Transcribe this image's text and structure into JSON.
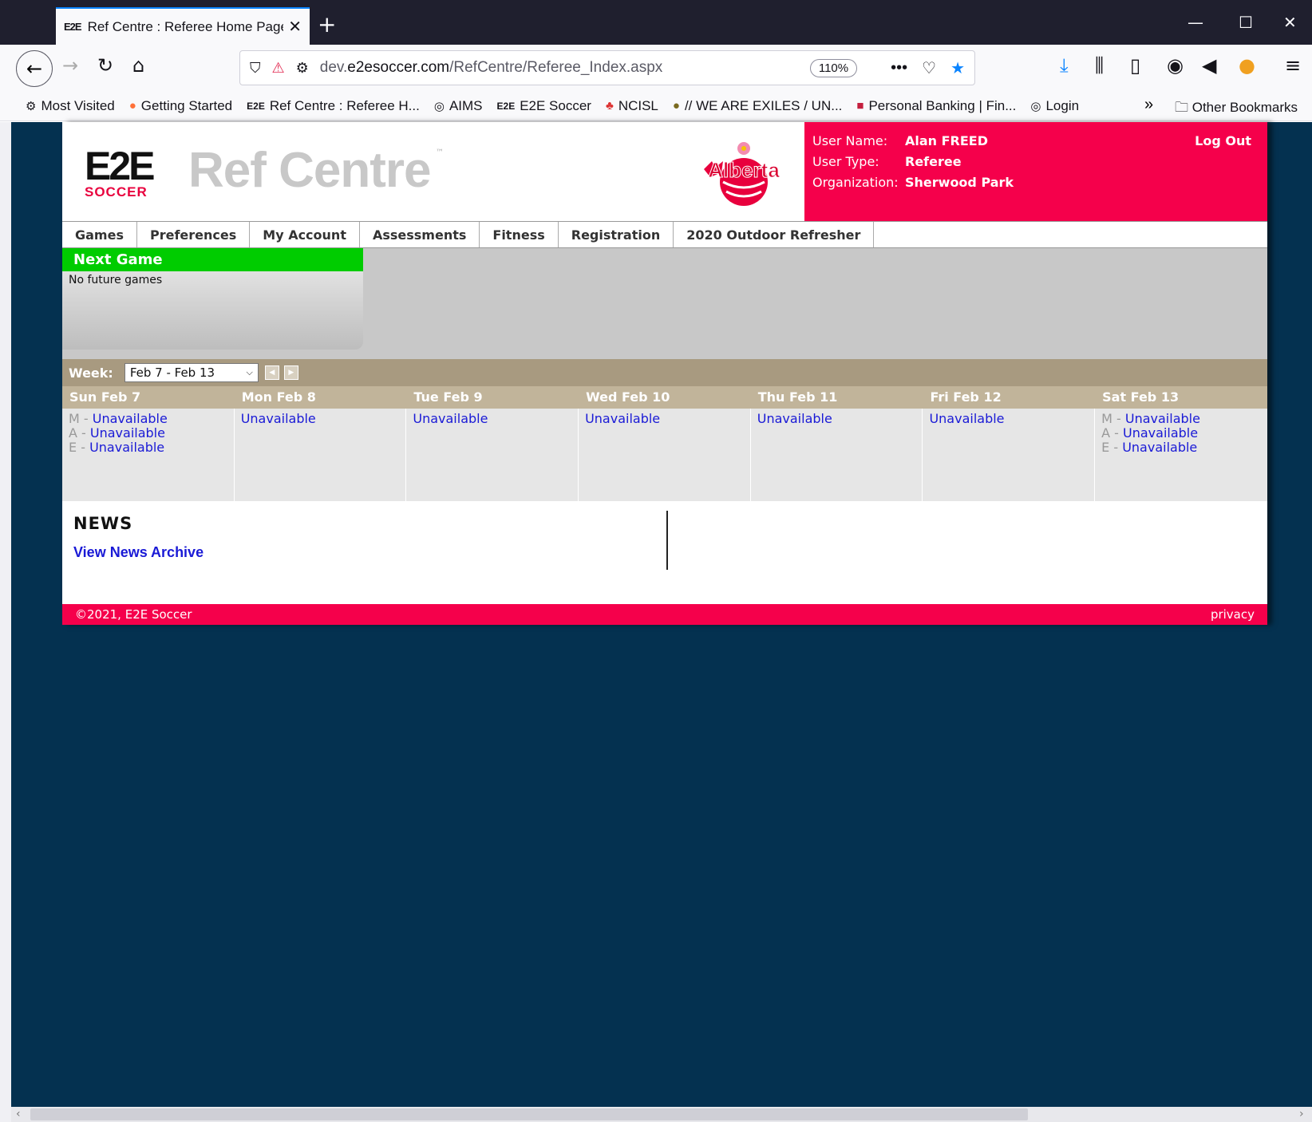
{
  "browser": {
    "tab_title": "Ref Centre : Referee Home Page",
    "tab_favicon": "E2E",
    "url_prefix": "dev.",
    "url_domain": "e2esoccer.com",
    "url_path": "/RefCentre/Referee_Index.aspx",
    "zoom": "110%",
    "bookmarks": [
      {
        "icon": "gear-icon",
        "glyph": "⚙",
        "label": "Most Visited"
      },
      {
        "icon": "firefox-icon",
        "glyph": "●",
        "label": "Getting Started"
      },
      {
        "icon": "e2e-icon",
        "glyph": "E2E",
        "label": "Ref Centre : Referee H..."
      },
      {
        "icon": "globe-icon",
        "glyph": "◎",
        "label": "AIMS"
      },
      {
        "icon": "e2e-icon",
        "glyph": "E2E",
        "label": "E2E Soccer"
      },
      {
        "icon": "ncisl-icon",
        "glyph": "♣",
        "label": "NCISL"
      },
      {
        "icon": "exiles-icon",
        "glyph": "●",
        "label": "// WE ARE EXILES / UN..."
      },
      {
        "icon": "cibc-icon",
        "glyph": "■",
        "label": "Personal Banking | Fin..."
      },
      {
        "icon": "globe-icon",
        "glyph": "◎",
        "label": "Login"
      }
    ],
    "other_bookmarks": "Other Bookmarks"
  },
  "site": {
    "logo_text": "E2E",
    "logo_sub": "SOCCER",
    "brand": "Ref Centre",
    "tm": "™",
    "alberta_logo": "Alberta"
  },
  "user": {
    "name_label": "User Name:",
    "name": "Alan FREED",
    "type_label": "User Type:",
    "type": "Referee",
    "org_label": "Organization:",
    "org": "Sherwood Park",
    "logout": "Log Out"
  },
  "menu": [
    "Games",
    "Preferences",
    "My Account",
    "Assessments",
    "Fitness",
    "Registration",
    "2020 Outdoor Refresher"
  ],
  "next_game": {
    "title": "Next Game",
    "text": "No future games"
  },
  "week": {
    "label": "Week:",
    "selected": "Feb 7 - Feb 13"
  },
  "days": [
    {
      "head": "Sun Feb 7",
      "slots": [
        {
          "p": "M - ",
          "v": "Unavailable"
        },
        {
          "p": "A - ",
          "v": "Unavailable"
        },
        {
          "p": "E - ",
          "v": "Unavailable"
        }
      ]
    },
    {
      "head": "Mon Feb 8",
      "slots": [
        {
          "p": "",
          "v": "Unavailable"
        }
      ]
    },
    {
      "head": "Tue Feb 9",
      "slots": [
        {
          "p": "",
          "v": "Unavailable"
        }
      ]
    },
    {
      "head": "Wed Feb 10",
      "slots": [
        {
          "p": "",
          "v": "Unavailable"
        }
      ]
    },
    {
      "head": "Thu Feb 11",
      "slots": [
        {
          "p": "",
          "v": "Unavailable"
        }
      ]
    },
    {
      "head": "Fri Feb 12",
      "slots": [
        {
          "p": "",
          "v": "Unavailable"
        }
      ]
    },
    {
      "head": "Sat Feb 13",
      "slots": [
        {
          "p": "M - ",
          "v": "Unavailable"
        },
        {
          "p": "A - ",
          "v": "Unavailable"
        },
        {
          "p": "E - ",
          "v": "Unavailable"
        }
      ]
    }
  ],
  "news": {
    "title": "NEWS",
    "archive": "View News Archive"
  },
  "footer": {
    "copyright": "©2021, E2E Soccer",
    "privacy": "privacy"
  },
  "colors": {
    "accent": "#f5004b",
    "page_bg": "#043150",
    "green": "#00cc00"
  }
}
